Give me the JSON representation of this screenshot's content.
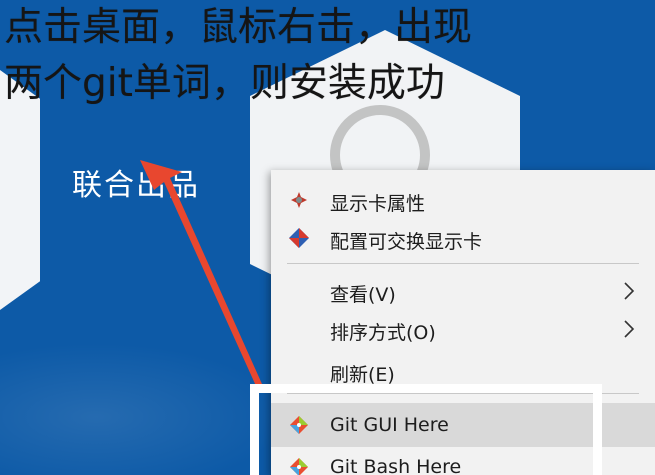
{
  "caption": {
    "line1": "点击桌面，鼠标右击，出现",
    "line2": "两个git单词，则安装成功"
  },
  "desktop": {
    "brand_label": "联合出品"
  },
  "context_menu": {
    "items": [
      {
        "label": "显示卡属性",
        "icon": "graphics-properties-icon"
      },
      {
        "label": "配置可交换显示卡",
        "icon": "switchable-graphics-icon"
      },
      {
        "label": "查看(V)",
        "has_submenu": true
      },
      {
        "label": "排序方式(O)",
        "has_submenu": true
      },
      {
        "label": "刷新(E)"
      },
      {
        "label": "Git GUI Here",
        "icon": "git-icon",
        "hovered": true
      },
      {
        "label": "Git Bash Here",
        "icon": "git-icon"
      }
    ]
  },
  "colors": {
    "desktop_blue": "#0d5aa7",
    "menu_bg": "#f2f2f2",
    "hover_bg": "#d9d9d9",
    "arrow": "#e8472f"
  }
}
